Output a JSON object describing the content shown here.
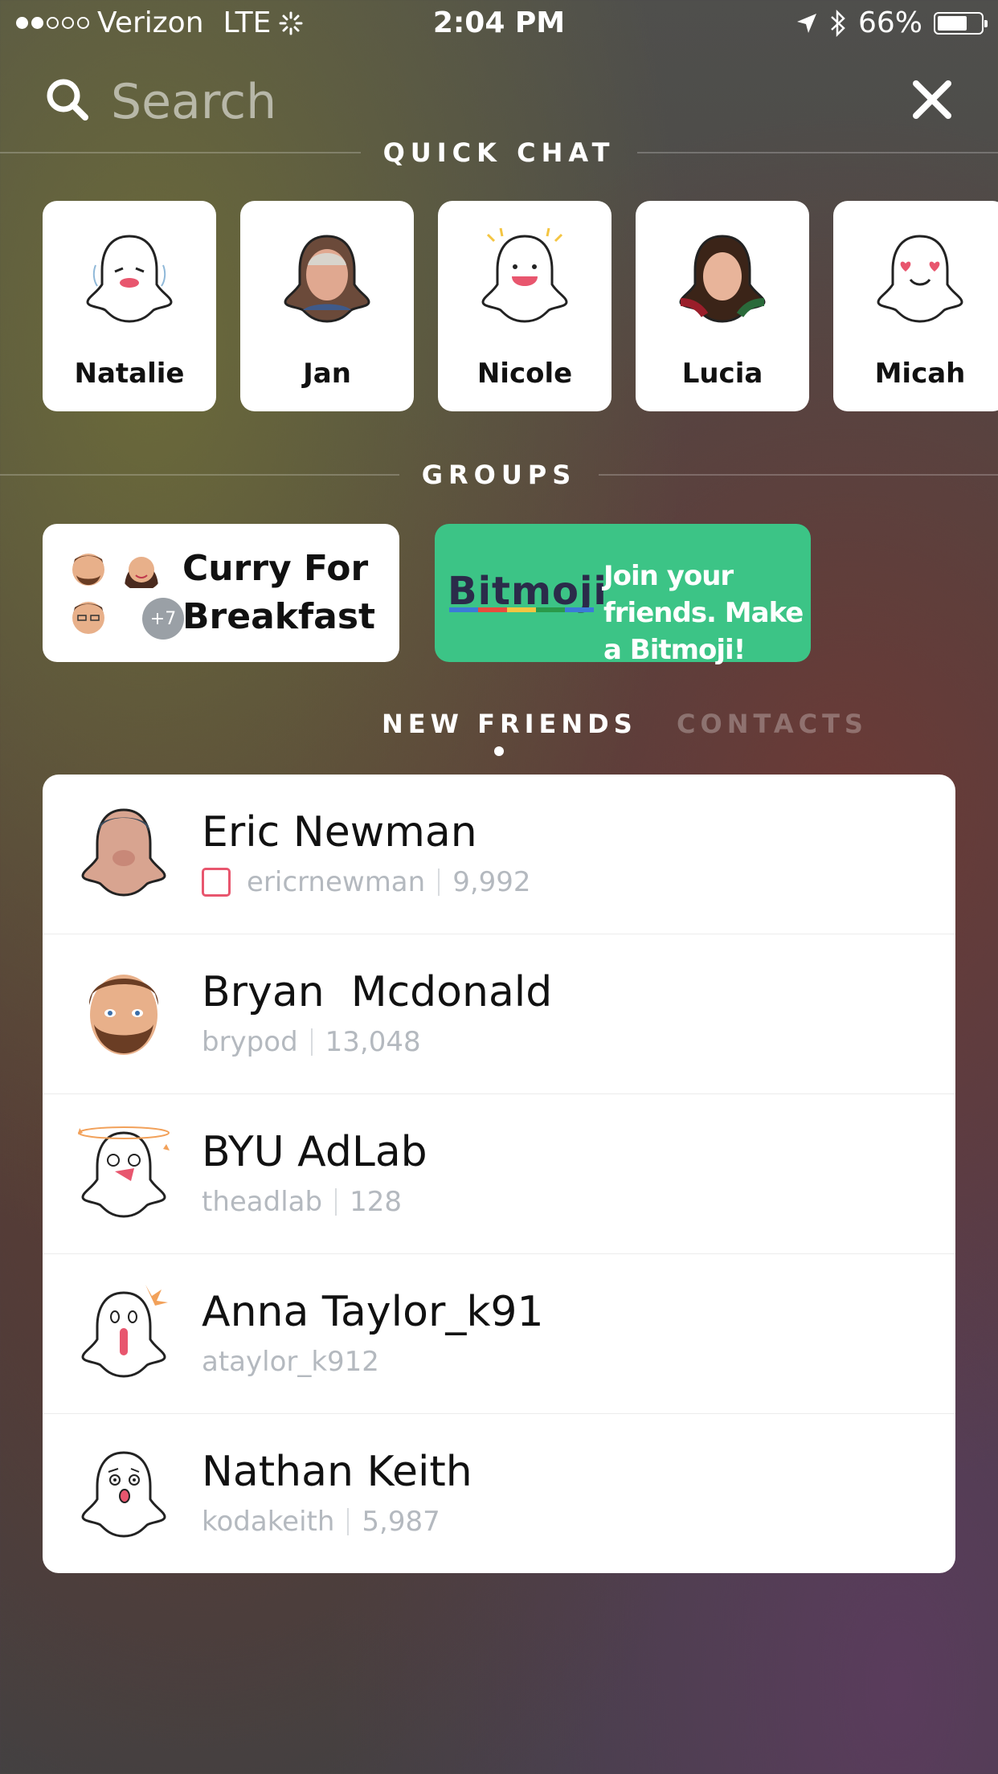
{
  "status_bar": {
    "carrier": "Verizon",
    "network": "LTE",
    "time": "2:04 PM",
    "battery": "66%",
    "battery_level": 0.66,
    "signal_bars_filled": 2,
    "signal_bars_total": 5
  },
  "search": {
    "placeholder": "Search"
  },
  "quick_chat": {
    "header": "QUICK CHAT",
    "friends": [
      {
        "name": "Natalie",
        "avatar": "sad-ghost-icon"
      },
      {
        "name": "Jan",
        "avatar": "face-photo-ghost"
      },
      {
        "name": "Nicole",
        "avatar": "happy-ghost-icon"
      },
      {
        "name": "Lucia",
        "avatar": "face-photo-ghost"
      },
      {
        "name": "Micah",
        "avatar": "heart-eyes-ghost-icon"
      }
    ]
  },
  "groups": {
    "header": "GROUPS",
    "group_name": "Curry For Breakfast",
    "extra_members": "+7",
    "bitmoji_logo": "Bitmoji",
    "bitmoji_promo": "Join your friends. Make a Bitmoji!"
  },
  "tabs": {
    "new_friends": "NEW FRIENDS",
    "contacts": "CONTACTS"
  },
  "new_friends": [
    {
      "name": "Eric Newman",
      "username": "ericrnewman",
      "score": "9,992",
      "avatar": "face-photo-ghost"
    },
    {
      "name": "Bryan  Mcdonald",
      "username": "brypod",
      "score": "13,048",
      "avatar": "bitmoji-avatar"
    },
    {
      "name": "BYU AdLab",
      "username": "theadlab",
      "score": "128",
      "avatar": "dizzy-ghost-icon"
    },
    {
      "name": "Anna Taylor_k91",
      "username": "ataylor_k912",
      "score": "",
      "avatar": "shocked-ghost-icon"
    },
    {
      "name": "Nathan Keith",
      "username": "kodakeith",
      "score": "5,987",
      "avatar": "worried-ghost-icon"
    }
  ],
  "colors": {
    "accent_green": "#3cc486",
    "snap_pink": "#e8566e"
  }
}
